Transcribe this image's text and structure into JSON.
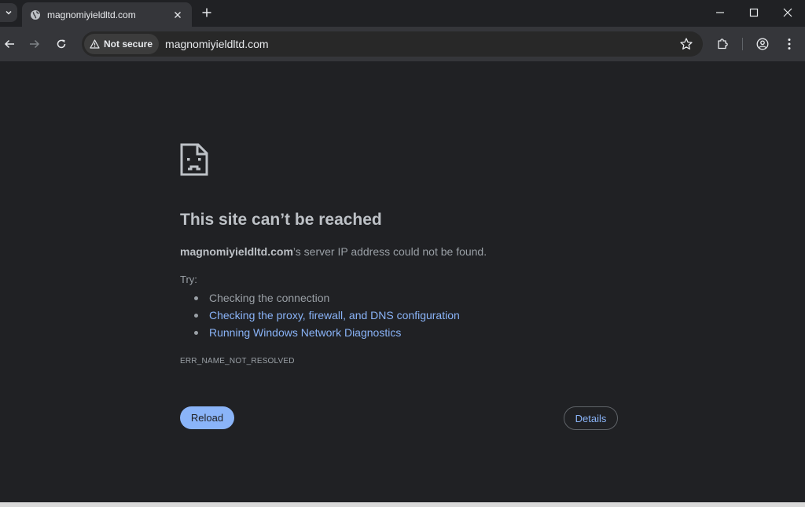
{
  "tab": {
    "title": "magnomiyieldltd.com"
  },
  "omnibox": {
    "security_label": "Not secure",
    "url": "magnomiyieldltd.com"
  },
  "error_page": {
    "heading": "This site can’t be reached",
    "host": "magnomiyieldltd.com",
    "description_suffix": "’s server IP address could not be found.",
    "try_label": "Try:",
    "suggestions": [
      "Checking the connection",
      "Checking the proxy, firewall, and DNS configuration",
      "Running Windows Network Diagnostics"
    ],
    "error_code": "ERR_NAME_NOT_RESOLVED",
    "reload_label": "Reload",
    "details_label": "Details"
  },
  "colors": {
    "background": "#202124",
    "toolbar": "#35363a",
    "link": "#8ab4f8",
    "text": "#9aa0a6"
  }
}
